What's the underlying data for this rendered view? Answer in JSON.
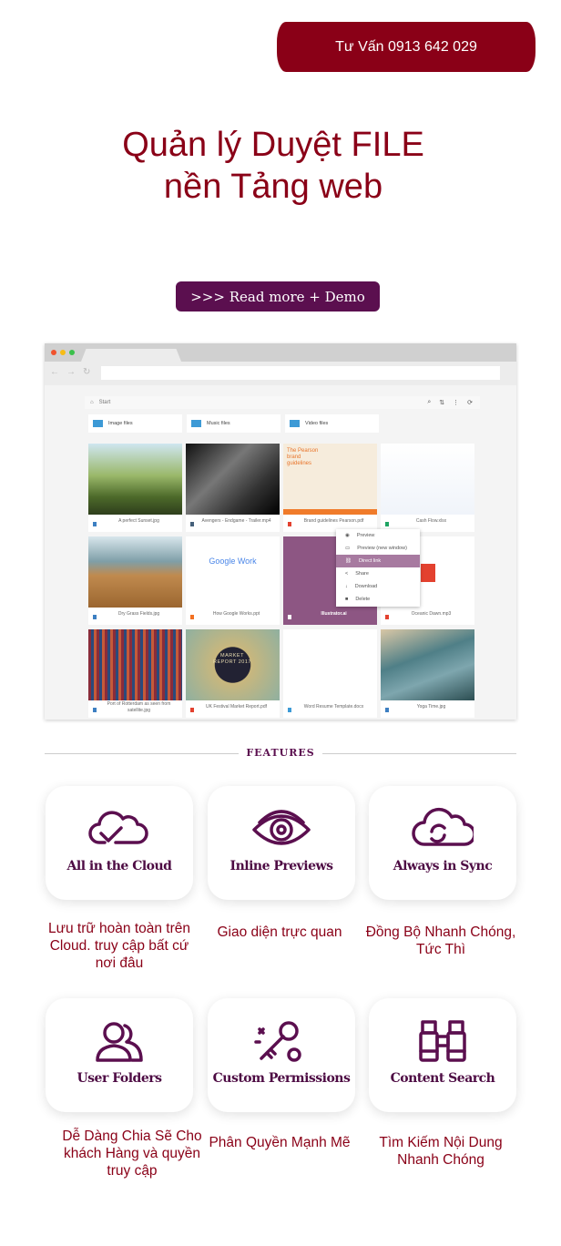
{
  "header": {
    "cta": "Tư Vấn 0913 642 029",
    "title_line1": "Quản lý Duyệt FILE",
    "title_line2": "nền Tảng web",
    "read_more": ">>> Read more + Demo"
  },
  "app": {
    "breadcrumb": "Start",
    "folders": [
      "Image files",
      "Music files",
      "Video files"
    ],
    "files": [
      {
        "name": "A perfect Sunset.jpg",
        "icon_color": "#3d7fc2"
      },
      {
        "name": "Avengers - Endgame - Trailer.mp4",
        "icon_color": "#45607a"
      },
      {
        "name": "Brand guidelines Pearson.pdf",
        "icon_color": "#e3412f"
      },
      {
        "name": "Cash Flow.xlsx",
        "icon_color": "#1fa463"
      },
      {
        "name": "Dry Grass Fields.jpg",
        "icon_color": "#3d7fc2"
      },
      {
        "name": "How Google Works.ppt",
        "icon_color": "#f37021"
      },
      {
        "name": "Illustrator.ai",
        "icon_color": "#ffffff"
      },
      {
        "name": "Oceanic Dawn.mp3",
        "icon_color": "#e3412f"
      },
      {
        "name": "Port of Rotterdam as seen from satellite.jpg",
        "icon_color": "#3d7fc2"
      },
      {
        "name": "UK Festival Market Report.pdf",
        "icon_color": "#e3412f"
      },
      {
        "name": "Word Resume Template.docx",
        "icon_color": "#3d9ad6"
      },
      {
        "name": "Yoga Time.jpg",
        "icon_color": "#3d7fc2"
      }
    ],
    "context_menu": [
      "Preview",
      "Preview (new window)",
      "Direct link",
      "Share",
      "Download",
      "Delete"
    ],
    "thumb_text": {
      "pearson": "The Pearson brand guidelines",
      "google": "Google Work",
      "market": "MARKET REPORT 2017"
    }
  },
  "features": {
    "heading": "FEATURES",
    "items": [
      {
        "title": "All in the Cloud",
        "desc": "Lưu trữ hoàn toàn trên Cloud. truy cập bất cứ nơi đâu"
      },
      {
        "title": "Inline Previews",
        "desc": "Giao diện trực quan"
      },
      {
        "title": "Always in Sync",
        "desc": "Đồng Bộ Nhanh Chóng, Tức Thì"
      },
      {
        "title": "User Folders",
        "desc": "Dễ Dàng Chia Sẽ Cho khách Hàng và quyền truy cập"
      },
      {
        "title": "Custom Permissions",
        "desc": "Phân Quyền Mạnh Mẽ"
      },
      {
        "title": "Content Search",
        "desc": "Tìm Kiếm Nội Dung Nhanh Chóng"
      }
    ]
  },
  "colors": {
    "brand": "#8a0017",
    "accent": "#5b0f4f"
  }
}
